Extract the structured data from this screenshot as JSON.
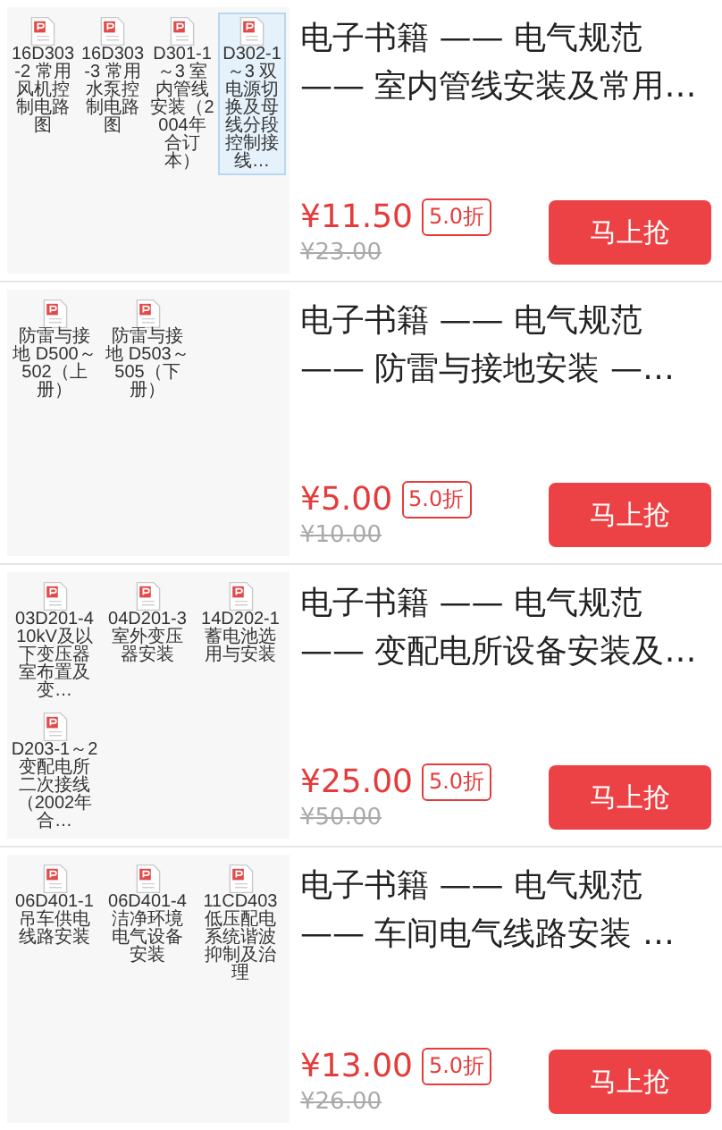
{
  "products": [
    {
      "files": [
        {
          "name": "16D303-2 常用风机控制电路图",
          "selected": false
        },
        {
          "name": "16D303-3 常用水泵控制电路图",
          "selected": false
        },
        {
          "name": "D301-1～3 室内管线安装（2004年合订本）",
          "selected": false
        },
        {
          "name": "D302-1～3 双电源切换及母线分段控制接线…",
          "selected": true
        }
      ],
      "title_lines": [
        "电子书籍 —— 电气规范",
        "—— 室内管线安装及常用…"
      ],
      "price": "¥11.50",
      "discount": "5.0折",
      "original_price": "¥23.00",
      "button": "马上抢"
    },
    {
      "files": [
        {
          "name": "防雷与接地 D500～502（上册）",
          "selected": false
        },
        {
          "name": "防雷与接地 D503～505（下册）",
          "selected": false
        }
      ],
      "title_lines": [
        "电子书籍 —— 电气规范",
        "—— 防雷与接地安装 —…"
      ],
      "price": "¥5.00",
      "discount": "5.0折",
      "original_price": "¥10.00",
      "button": "马上抢"
    },
    {
      "files": [
        {
          "name": "03D201-4 10kV及以下变压器室布置及变…",
          "selected": false
        },
        {
          "name": "04D201-3 室外变压器安装",
          "selected": false
        },
        {
          "name": "14D202-1 蓄电池选用与安装",
          "selected": false
        },
        {
          "name": "D203-1～2 变配电所二次接线（2002年合…",
          "selected": false
        }
      ],
      "title_lines": [
        "电子书籍 —— 电气规范",
        "—— 变配电所设备安装及…"
      ],
      "price": "¥25.00",
      "discount": "5.0折",
      "original_price": "¥50.00",
      "button": "马上抢"
    },
    {
      "files": [
        {
          "name": "06D401-1 吊车供电线路安装",
          "selected": false
        },
        {
          "name": "06D401-4 洁净环境电气设备安装",
          "selected": false
        },
        {
          "name": "11CD403 低压配电系统谐波抑制及治理",
          "selected": false
        }
      ],
      "title_lines": [
        "电子书籍 —— 电气规范",
        "—— 车间电气线路安装 …"
      ],
      "price": "¥13.00",
      "discount": "5.0折",
      "original_price": "¥26.00",
      "button": "马上抢"
    }
  ]
}
